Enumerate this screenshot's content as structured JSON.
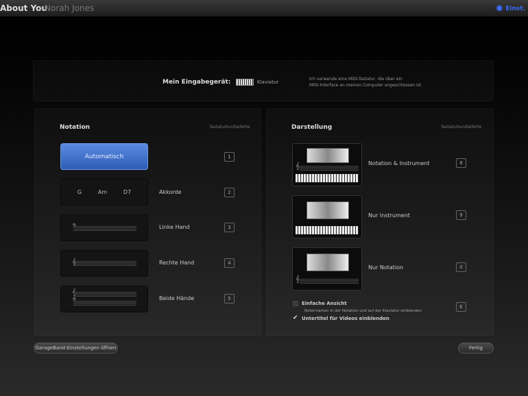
{
  "topbar": {
    "title": "About You",
    "subtitle": "Norah Jones",
    "settings_label": "Einst."
  },
  "input_device": {
    "label": "Mein Eingabegerät:",
    "device": "Klaviatur",
    "description_line1": "Ich verwende eine MIDI-Tastatur, die über ein",
    "description_line2": "MIDI-Interface an meinen Computer angeschlossen ist."
  },
  "notation": {
    "title": "Notation",
    "shortcuts_header": "Tastaturkurzbefehle",
    "automatic": {
      "label": "Automatisch",
      "key": "1"
    },
    "chords": {
      "chords": [
        "G",
        "Am",
        "D7"
      ],
      "label": "Akkorde",
      "key": "2"
    },
    "left_hand": {
      "label": "Linke Hand",
      "key": "3"
    },
    "right_hand": {
      "label": "Rechte Hand",
      "key": "4"
    },
    "both_hands": {
      "label": "Beide Hände",
      "key": "5"
    }
  },
  "display": {
    "title": "Darstellung",
    "shortcuts_header": "Tastaturkurzbefehle",
    "items": [
      {
        "label": "Notation & Instrument",
        "key": "8"
      },
      {
        "label": "Nur Instrument",
        "key": "9"
      },
      {
        "label": "Nur Notation",
        "key": "0"
      }
    ],
    "simple_view": {
      "label": "Einfache Ansicht",
      "description": "Notennamen in der Notation und auf der Klaviatur einblenden",
      "key": "E",
      "checked": false
    },
    "subtitles": {
      "label": "Untertitel für Videos einblenden",
      "checked": true
    }
  },
  "footer": {
    "settings_button": "GarageBand-Einstellungen öffnen",
    "done_button": "Fertig"
  }
}
